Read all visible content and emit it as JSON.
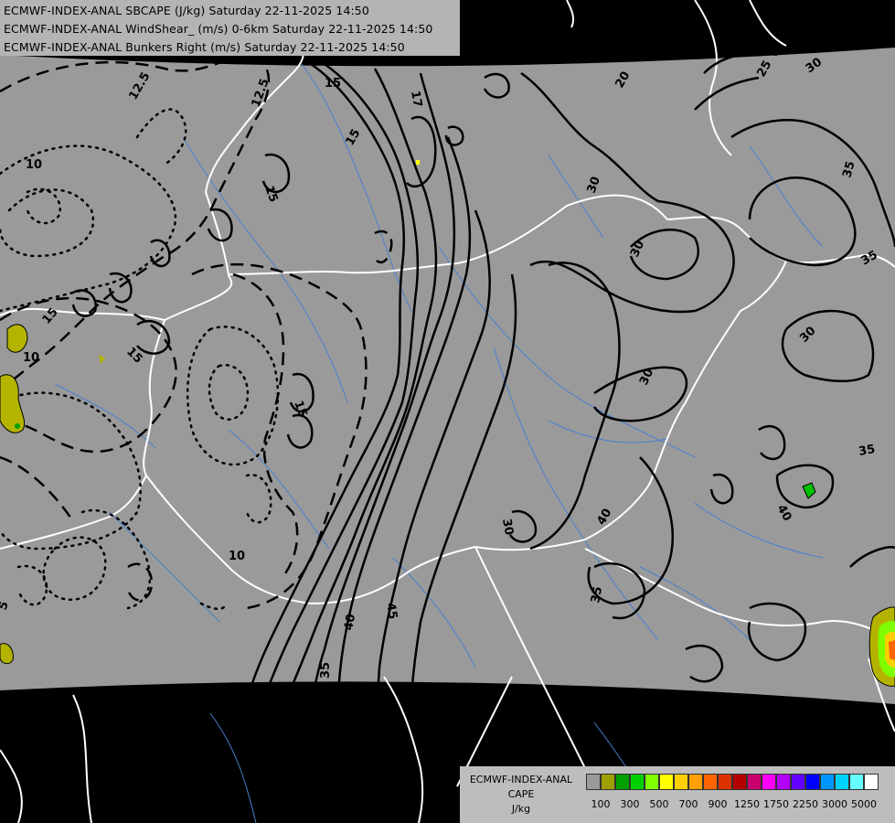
{
  "titles": [
    "ECMWF-INDEX-ANAL SBCAPE (J/kg) Saturday 22-11-2025 14:50",
    "ECMWF-INDEX-ANAL WindShear_ (m/s) 0-6km Saturday 22-11-2025 14:50",
    "ECMWF-INDEX-ANAL Bunkers Right (m/s) Saturday 22-11-2025 14:50"
  ],
  "legend": {
    "model": "ECMWF-INDEX-ANAL",
    "field": "CAPE",
    "unit": "J/kg",
    "swatches": [
      "#9a9a9a",
      "#9f9f00",
      "#00a000",
      "#00d000",
      "#7fff00",
      "#ffff00",
      "#ffd000",
      "#ffa000",
      "#ff6400",
      "#dc3200",
      "#b40000",
      "#c8006e",
      "#ff00ff",
      "#b400ff",
      "#6400ff",
      "#0000ff",
      "#0096ff",
      "#00d2ff",
      "#64ffff",
      "#ffffff"
    ],
    "ticks": [
      "100",
      "300",
      "500",
      "700",
      "900",
      "1250",
      "1750",
      "2250",
      "3000",
      "5000"
    ]
  },
  "contour_labels": {
    "c12_5a": "12.5",
    "c12_5b": "12.5",
    "c10a": "10",
    "c10b": "10",
    "c10c": "10",
    "c15a": "15",
    "c15b": "15",
    "c15c": "15",
    "c15d": "15",
    "c15e": "15",
    "c15f": "15",
    "c17": "17",
    "c20": "20",
    "c25": "25",
    "c30a": "30",
    "c30b": "30",
    "c30c": "30",
    "c30d": "30",
    "c30e": "30",
    "c30f": "30",
    "c35a": "35",
    "c35b": "35",
    "c35c": "35",
    "c35d": "35",
    "c35e": "35",
    "c40a": "40",
    "c40b": "40",
    "c40c": "40",
    "c40d": "40",
    "c45": "45",
    "c5": "5"
  },
  "colors": {
    "background": "#000000",
    "domain_fill": "#9a9a9a",
    "borders": "#ffffff",
    "rivers": "#4a7fd0",
    "contours": "#000000",
    "cape_low": "#b4b400",
    "cape_mid": "#00a000",
    "cape_high": "#ffa000"
  }
}
